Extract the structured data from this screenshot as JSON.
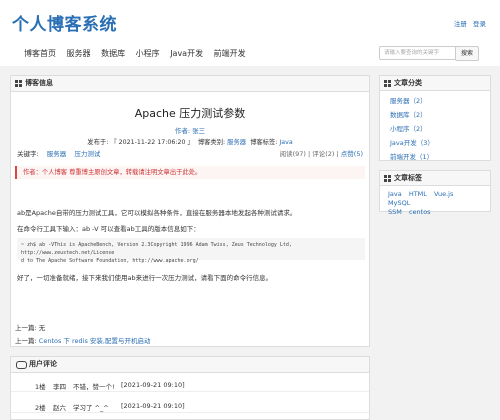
{
  "header": {
    "site_title": "个人博客系统",
    "register": "注册",
    "login": "登录",
    "nav": [
      "博客首页",
      "服务器",
      "数据库",
      "小程序",
      "Java开发",
      "前端开发"
    ],
    "search_placeholder": "请输入要查询的关键字",
    "search_button": "搜索"
  },
  "article": {
    "panel_title": "博客信息",
    "title": "Apache 压力测试参数",
    "author_label": "作者:",
    "author": "张三",
    "published_label": "发布于:",
    "published": "『 2021-11-22 17:06:20 』",
    "category_label": "博客类别:",
    "category": "服务器",
    "tag_label": "博客标签:",
    "tag": "Java",
    "keywords_label": "关键字:",
    "keywords": [
      "服务器",
      "压力测试"
    ],
    "stats": {
      "read": "阅读(97)",
      "comment": "评论(2)",
      "like": "点赞(5)"
    },
    "notice": "作者：个人博客     尊重博主原创文章，转载请注明文章出于此处。",
    "para1": "ab是Apache自带的压力测试工具，它可以模拟各种条件，直接在服务器本地发起各种测试请求。",
    "para2": "在命令行工具下输入：ab -V 可以查看ab工具的版本信息如下：",
    "code_line1": "~ zh$ ab -VThis is ApacheBench, Version 2.3Copyright 1996 Adam Twiss, Zeus Technology Ltd, http://www.zeustech.net/License",
    "code_line2": "d to The Apache Software Foundation, http://www.apache.org/",
    "para3": "好了，一切准备就绪，接下来我们使用ab来进行一次压力测试，请看下面的命令行信息。",
    "prev_label": "上一篇:",
    "prev": "无",
    "next_label": "上一篇:",
    "next": "Centos 下 redis 安装,配置与开机启动"
  },
  "sidebar": {
    "categories_title": "文章分类",
    "categories": [
      "服务器（2）",
      "数据库（2）",
      "小程序（2）",
      "Java开发（3）",
      "前端开发（1）"
    ],
    "tags_title": "文章标签",
    "tags": [
      "Java",
      "HTML",
      "Vue.js",
      "MySQL",
      "SSM",
      "centos"
    ]
  },
  "comments": {
    "title": "用户评论",
    "rows": [
      {
        "floor": "1楼",
        "user": "李四",
        "text": "不错，赞一个!",
        "time": "[2021-09-21 09:10]"
      },
      {
        "floor": "2楼",
        "user": "赵六",
        "text": "学习了 ^_^",
        "time": "[2021-09-21 09:10]"
      }
    ]
  }
}
